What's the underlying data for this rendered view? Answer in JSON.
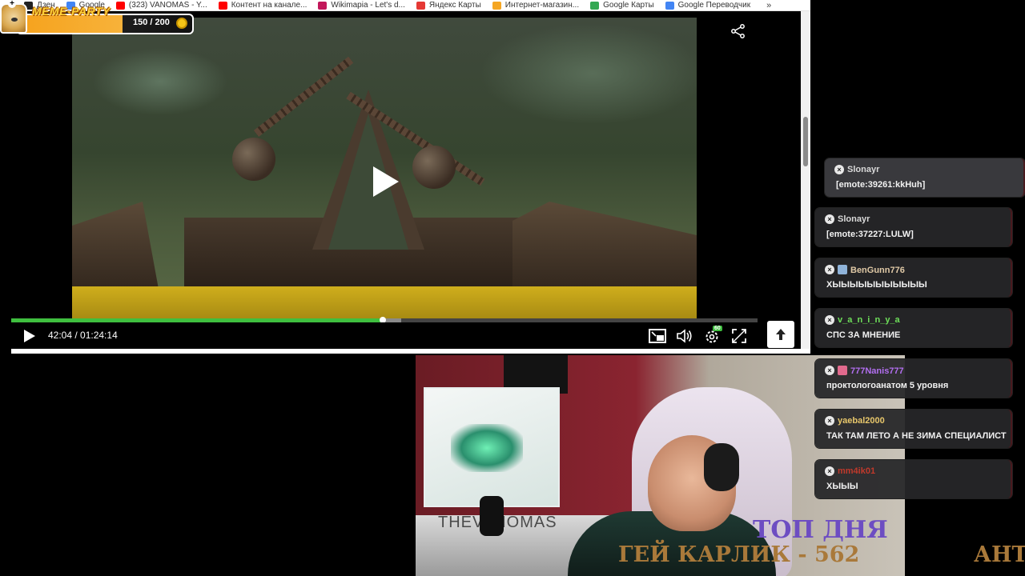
{
  "bookmarks": [
    {
      "label": "Дзен",
      "color": "#222222"
    },
    {
      "label": "Google",
      "color": "#4285f4"
    },
    {
      "label": "(323) VANOMAS - Y...",
      "color": "#ff0000"
    },
    {
      "label": "Контент на канале...",
      "color": "#ff0000"
    },
    {
      "label": "Wikimapia - Let's d...",
      "color": "#c2185b"
    },
    {
      "label": "Яндекс Карты",
      "color": "#e53935"
    },
    {
      "label": "Интернет-магазин...",
      "color": "#f5a623"
    },
    {
      "label": "Google Карты",
      "color": "#34a853"
    },
    {
      "label": "Google Переводчик",
      "color": "#4285f4"
    }
  ],
  "bookmarks_more": "»",
  "meme_party": {
    "title": "MEME-PARTY",
    "count": "150 / 200",
    "progress_fraction": 0.75
  },
  "player": {
    "time": "42:04 / 01:24:14",
    "progress_fraction": 0.498,
    "buffered_fraction": 0.522,
    "quality_badge": "60",
    "accent": "#3fbf3f"
  },
  "chat": {
    "messages": [
      {
        "user": "Slonayr",
        "text": "[emote:39261:kkHuh]",
        "color": "#d9d9d9",
        "badge": ""
      },
      {
        "user": "Slonayr",
        "text": "[emote:37227:LULW]",
        "color": "#d9d9d9",
        "badge": ""
      },
      {
        "user": "BenGunn776",
        "text": "ХЫЫЫЫЫЫЫЫЫЫЫ",
        "color": "#e0c9a6",
        "badge": "#8fb3d9"
      },
      {
        "user": "v_a_n_i_n_y_a",
        "text": "СПС ЗА МНЕНИЕ",
        "color": "#6ee05a",
        "badge": ""
      },
      {
        "user": "777Nanis777",
        "text": "проктологоанатом 5 уровня",
        "color": "#b26ef0",
        "badge": "#e26a8d"
      },
      {
        "user": "yaebal2000",
        "text": "ТАК ТАМ ЛЕТО А НЕ ЗИМА СПЕЦИАЛИСТ",
        "color": "#e8c76b",
        "badge": ""
      },
      {
        "user": "mm4ik01",
        "text": "ХЫЫЫ",
        "color": "#c0392b",
        "badge": ""
      }
    ]
  },
  "overlay": {
    "top_day": "ТОП ДНЯ",
    "rank_line": "ГЕЙ КАРЛИК - 562",
    "right_fragment": "АНТ"
  }
}
